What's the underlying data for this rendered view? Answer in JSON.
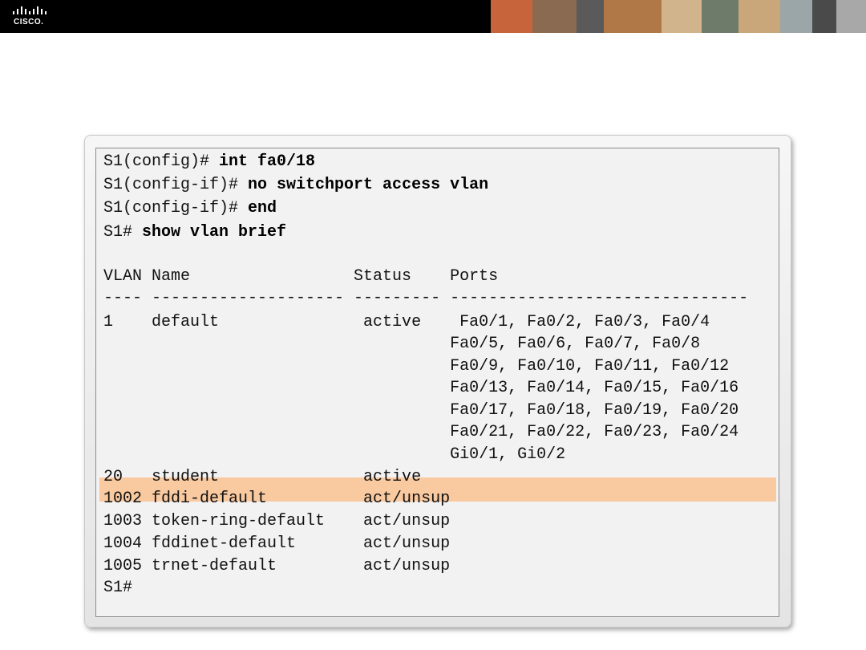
{
  "header": {
    "logo_text": "CISCO.",
    "logo_icon": "cisco-bridge-bars-icon",
    "photos": [
      {
        "name": "photo-1",
        "color": "#c8643c"
      },
      {
        "name": "photo-2",
        "color": "#8a6a50"
      },
      {
        "name": "photo-3",
        "color": "#5a5a5a"
      },
      {
        "name": "photo-4",
        "color": "#b07846"
      },
      {
        "name": "photo-5",
        "color": "#d2b48c"
      },
      {
        "name": "photo-6",
        "color": "#6e7a6a"
      },
      {
        "name": "photo-7",
        "color": "#c9a77a"
      },
      {
        "name": "photo-8",
        "color": "#9aa6a8"
      },
      {
        "name": "photo-9",
        "color": "#4a4a4a"
      },
      {
        "name": "photo-10",
        "color": "#a8a8a8"
      }
    ]
  },
  "terminal": {
    "highlight_color": "#f9c9a0",
    "commands": [
      {
        "prompt": "S1(config)# ",
        "command": "int fa0/18"
      },
      {
        "prompt": "S1(config-if)# ",
        "command": "no switchport access vlan"
      },
      {
        "prompt": "S1(config-if)# ",
        "command": "end"
      },
      {
        "prompt": "S1# ",
        "command": "show vlan brief"
      }
    ],
    "header_line": "VLAN Name                 Status    Ports",
    "separator_line": "---- -------------------- --------- -------------------------------",
    "output_lines": [
      "1    default               active    Fa0/1, Fa0/2, Fa0/3, Fa0/4",
      "                                    Fa0/5, Fa0/6, Fa0/7, Fa0/8",
      "                                    Fa0/9, Fa0/10, Fa0/11, Fa0/12",
      "                                    Fa0/13, Fa0/14, Fa0/15, Fa0/16",
      "                                    Fa0/17, Fa0/18, Fa0/19, Fa0/20",
      "                                    Fa0/21, Fa0/22, Fa0/23, Fa0/24",
      "                                    Gi0/1, Gi0/2",
      "20   student               active",
      "1002 fddi-default          act/unsup",
      "1003 token-ring-default    act/unsup",
      "1004 fddinet-default       act/unsup",
      "1005 trnet-default         act/unsup"
    ],
    "final_prompt": "S1#"
  }
}
